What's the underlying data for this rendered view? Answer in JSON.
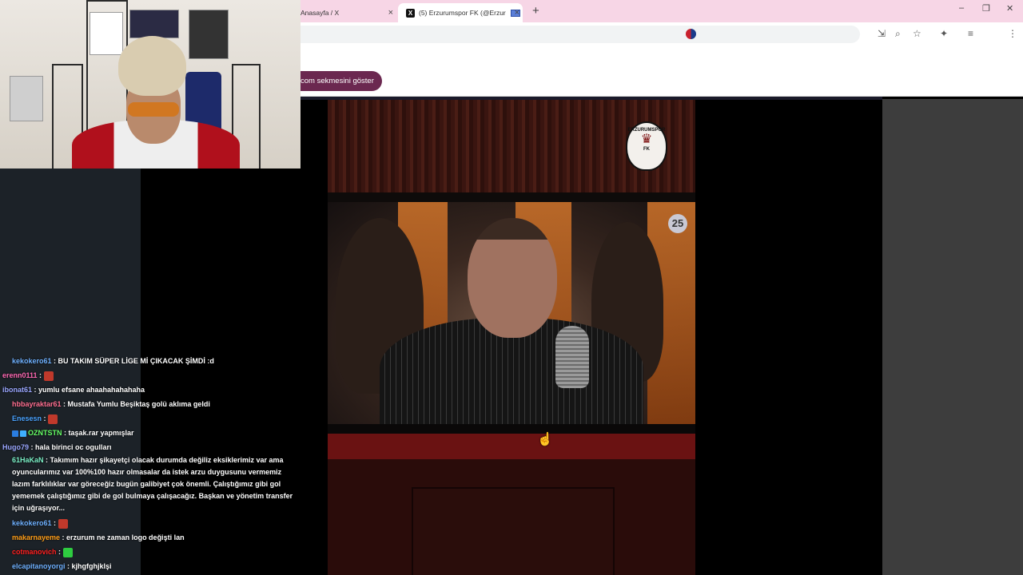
{
  "browser": {
    "tabs": [
      {
        "title": "Anasayfa / X",
        "active": false
      },
      {
        "title": "(5) Erzurumspor FK (@Erzur",
        "active": true
      }
    ],
    "new_tab_symbol": "+",
    "close_symbol": "×",
    "window_controls": [
      "–",
      "❐",
      "✕"
    ],
    "infobar_button": "com sekmesini göster"
  },
  "video": {
    "logo_text": "ERZURUMSPOR",
    "logo_bottom": "FK",
    "counter_badge": "25"
  },
  "chat": {
    "messages": [
      {
        "user": "kekokero61",
        "user_color": "#6fb1ff",
        "text": ": BU TAKIM SÜPER LİGE Mİ ÇIKACAK ŞİMDİ :d",
        "indent": true
      },
      {
        "user": "erenn0111",
        "user_color": "#ff69b4",
        "text": ":",
        "emote": "#c0392b",
        "indent": false
      },
      {
        "user": "ibonat61",
        "user_color": "#9aa7ff",
        "text": ": yumlu efsane ahaahahahahaha",
        "indent": false
      },
      {
        "user": "hbbayraktar61",
        "user_color": "#ff6f91",
        "text": ": Mustafa Yumlu Beşiktaş golü aklıma geldi",
        "indent": true
      },
      {
        "user": "Enesesn",
        "user_color": "#4aa3ff",
        "text": ":",
        "emote": "#c0392b",
        "indent": true
      },
      {
        "user": "OZNTSTN",
        "user_color": "#66ff66",
        "text": ": taşak.rar yapmışlar",
        "indent": true,
        "badges": true
      },
      {
        "user": "Hugo79",
        "user_color": "#9aa7ff",
        "text": ": hala birinci oc ogulları",
        "indent": false
      },
      {
        "user": "61HaKaN",
        "user_color": "#7cf2c8",
        "text": ": Takımım hazır şikayetçi olacak durumda değiliz eksiklerimiz var ama oyuncularımız var 100%100 hazır olmasalar da istek arzu duygusunu vermemiz lazım farklılıklar var göreceğiz bugün galibiyet çok önemli. Çalıştığımız gibi gol yememek çalıştığımız gibi de gol bulmaya çalışacağız. Başkan ve yönetim transfer için uğraşıyor...",
        "indent": true,
        "long": true
      },
      {
        "user": "kekokero61",
        "user_color": "#6fb1ff",
        "text": ":",
        "emote": "#c0392b",
        "indent": true
      },
      {
        "user": "makarnayeme",
        "user_color": "#ff9f1a",
        "text": ": erzurum ne zaman logo değişti lan",
        "indent": true
      },
      {
        "user": "cotmanovich",
        "user_color": "#ff2020",
        "text": ":",
        "emote": "#2ecc40",
        "indent": true
      },
      {
        "user": "elcapitanoyorgi",
        "user_color": "#6fb1ff",
        "text": ": kjhgfghjklşi",
        "indent": true
      }
    ]
  },
  "colors": {
    "tabbar": "#f7d6e6",
    "infobar_button": "#6b2850",
    "chat_bg": "#1c2228"
  }
}
